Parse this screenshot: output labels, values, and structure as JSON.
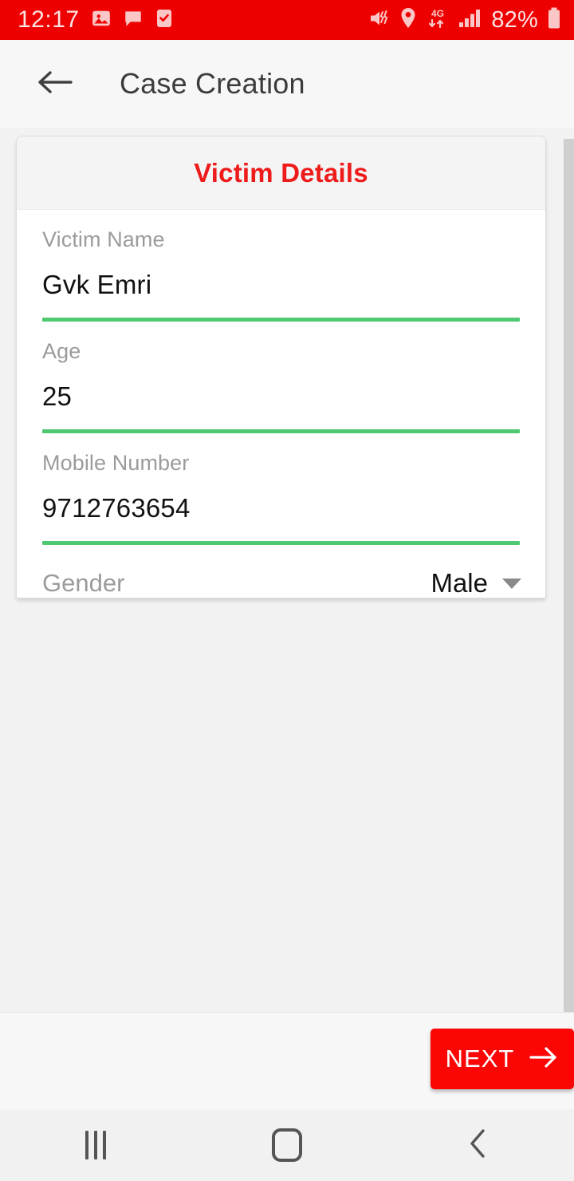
{
  "status_bar": {
    "time": "12:17",
    "battery_text": "82%",
    "network_type": "4G",
    "background_color": "#ef0000",
    "left_icons": [
      "image-icon",
      "chat-icon",
      "task-checkbox-icon"
    ],
    "right_icons": [
      "mute-vibrate-icon",
      "location-pin-icon",
      "data-transfer-icon",
      "signal-bars-icon",
      "battery-icon"
    ]
  },
  "toolbar": {
    "back_icon": "back-arrow-icon",
    "title": "Case Creation"
  },
  "card": {
    "title": "Victim Details",
    "title_color": "#ee1b1b",
    "underline_color": "#4ec972",
    "fields": [
      {
        "label": "Victim Name",
        "value": "Gvk Emri"
      },
      {
        "label": "Age",
        "value": "25"
      },
      {
        "label": "Mobile Number",
        "value": "9712763654"
      }
    ],
    "dropdown": {
      "label": "Gender",
      "value": "Male",
      "caret_icon": "chevron-down-icon"
    }
  },
  "footer": {
    "next_label": "NEXT",
    "next_icon": "arrow-right-icon",
    "next_color": "#fb0505"
  },
  "navbar": {
    "recents_icon": "recents-icon",
    "home_icon": "home-icon",
    "back_icon": "nav-back-icon"
  }
}
